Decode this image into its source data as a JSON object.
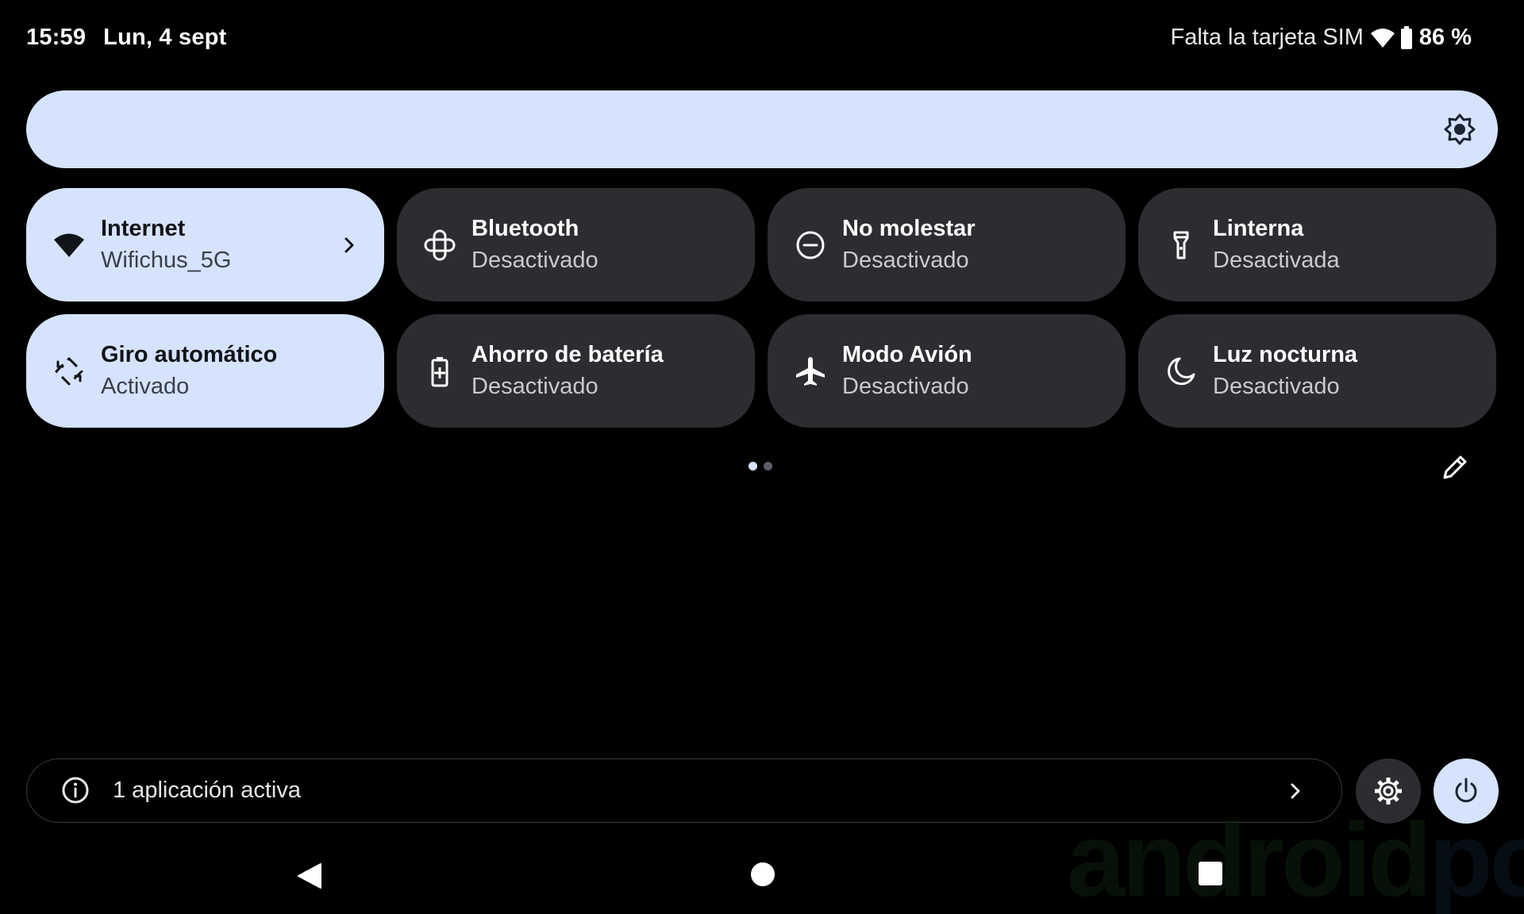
{
  "status_bar": {
    "time": "15:59",
    "date": "Lun, 4 sept",
    "sim_status": "Falta la tarjeta SIM",
    "battery_percent": "86 %",
    "icons": [
      "wifi-icon",
      "battery-icon"
    ]
  },
  "brightness": {
    "icon": "brightness-icon",
    "level_fraction": 1.0
  },
  "tiles": [
    {
      "id": "internet",
      "title": "Internet",
      "subtitle": "Wifichus_5G",
      "icon": "wifi-icon",
      "active": true,
      "has_chevron": true
    },
    {
      "id": "bluetooth",
      "title": "Bluetooth",
      "subtitle": "Desactivado",
      "icon": "bluetooth-icon",
      "active": false
    },
    {
      "id": "dnd",
      "title": "No molestar",
      "subtitle": "Desactivado",
      "icon": "do-not-disturb-icon",
      "active": false
    },
    {
      "id": "flashlight",
      "title": "Linterna",
      "subtitle": "Desactivada",
      "icon": "flashlight-icon",
      "active": false
    },
    {
      "id": "autorotate",
      "title": "Giro automático",
      "subtitle": "Activado",
      "icon": "auto-rotate-icon",
      "active": true
    },
    {
      "id": "battery_saver",
      "title": "Ahorro de batería",
      "subtitle": "Desactivado",
      "icon": "battery-saver-icon",
      "active": false
    },
    {
      "id": "airplane",
      "title": "Modo Avión",
      "subtitle": "Desactivado",
      "icon": "airplane-icon",
      "active": false
    },
    {
      "id": "night_light",
      "title": "Luz nocturna",
      "subtitle": "Desactivado",
      "icon": "night-light-icon",
      "active": false
    }
  ],
  "pager": {
    "pages": 2,
    "current": 1
  },
  "footer": {
    "active_apps_label": "1 aplicación activa",
    "info_icon": "info-icon",
    "settings_icon": "gear-icon",
    "power_icon": "power-icon"
  },
  "navigation": [
    "back",
    "home",
    "recents"
  ],
  "watermark": {
    "part1": "android",
    "part2": "pc"
  },
  "colors": {
    "background": "#000000",
    "tile_inactive": "#2c2d31",
    "tile_active": "#d6e3ff",
    "text_primary": "#ffffff",
    "text_secondary": "#c9cacf"
  }
}
